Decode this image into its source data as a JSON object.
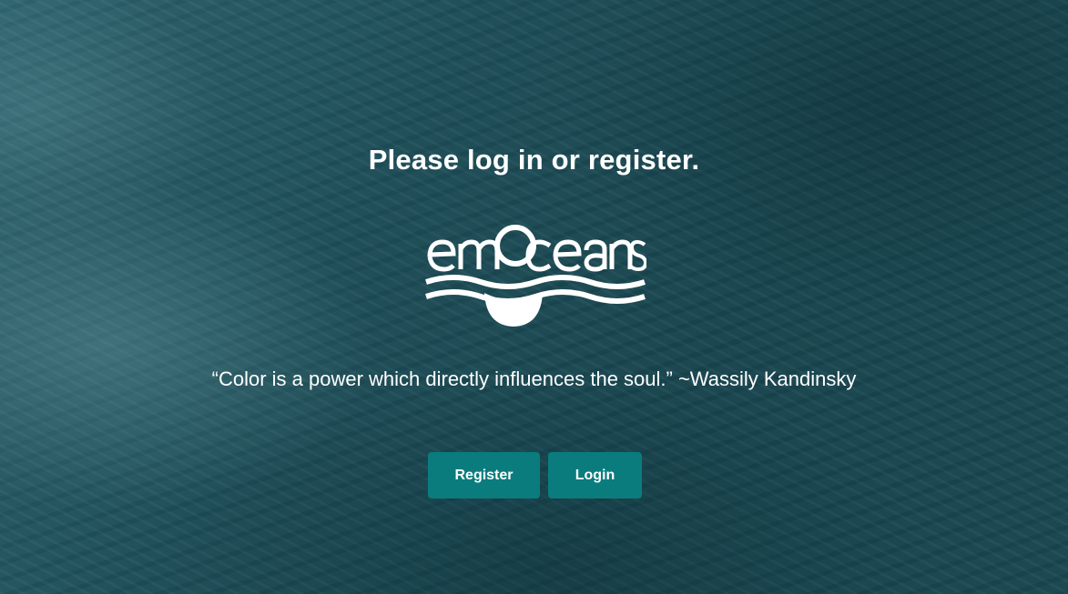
{
  "page": {
    "heading": "Please log in or register.",
    "quote": "“Color is a power which directly influences the soul.” ~Wassily Kandinsky"
  },
  "logo": {
    "text": "emOceans"
  },
  "actions": {
    "register_label": "Register",
    "login_label": "Login"
  },
  "colors": {
    "ocean": "#1d4b55",
    "button": "#0b7c7d",
    "text": "#ffffff"
  }
}
